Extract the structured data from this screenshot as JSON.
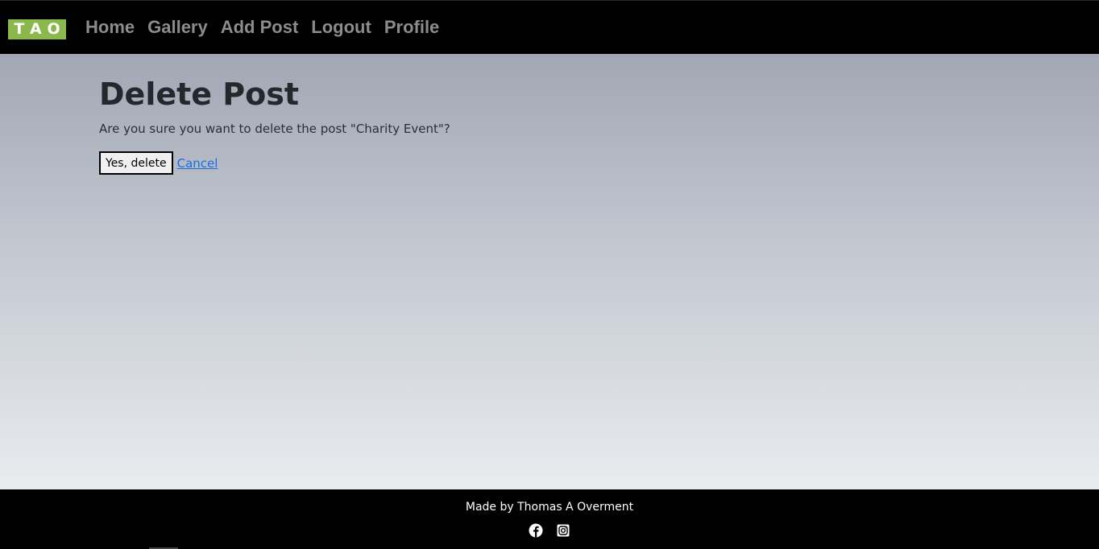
{
  "navbar": {
    "logo_letters": [
      "T",
      "A",
      "O"
    ],
    "links": [
      {
        "label": "Home"
      },
      {
        "label": "Gallery"
      },
      {
        "label": "Add Post"
      },
      {
        "label": "Logout"
      },
      {
        "label": "Profile"
      }
    ]
  },
  "main": {
    "title": "Delete Post",
    "confirm_text": "Are you sure you want to delete the post \"Charity Event\"?",
    "delete_button": "Yes, delete",
    "cancel_link": "Cancel"
  },
  "footer": {
    "credit": "Made by Thomas A Overment",
    "social_icons": [
      "facebook-icon",
      "instagram-icon"
    ]
  },
  "colors": {
    "navbar_bg": "#000000",
    "nav_link": "#8c8c8c",
    "logo_bg": "#8ab84a",
    "link": "#1a6de0",
    "footer_bg": "#000000"
  }
}
